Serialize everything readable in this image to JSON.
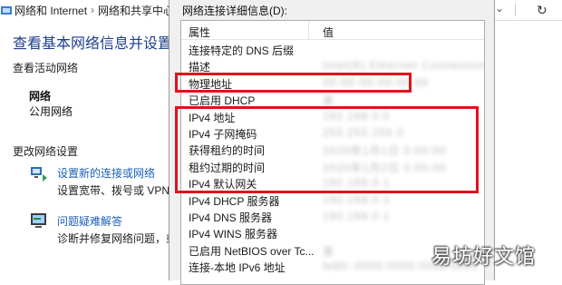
{
  "window": {
    "breadcrumb": [
      "网络和 Internet",
      "网络和共享中心"
    ],
    "icons": {
      "folder": "network-folder-icon",
      "refresh": "refresh-icon",
      "chevron": "chevron-down-icon"
    }
  },
  "page": {
    "title": "查看基本网络信息并设置连",
    "active_network_label": "查看活动网络",
    "network_name": "网络",
    "network_type": "公用网络",
    "change_settings_label": "更改网络设置",
    "actions": [
      {
        "link": "设置新的连接或网络",
        "desc": "设置宽带、拨号或 VPN 连",
        "icon": "network-setup-icon"
      },
      {
        "link": "问题疑难解答",
        "desc": "诊断并修复网络问题，或",
        "icon": "troubleshoot-icon"
      }
    ]
  },
  "dialog": {
    "label": "网络连接详细信息(D):",
    "columns": {
      "property": "属性",
      "value": "值"
    },
    "rows": [
      {
        "key": "连接特定的 DNS 后缀",
        "value": ""
      },
      {
        "key": "描述",
        "value": "Intel(R) Ethernet Connection"
      },
      {
        "key": "物理地址",
        "value": "00-00-00-00-00-00"
      },
      {
        "key": "已启用 DHCP",
        "value": "是"
      },
      {
        "key": "IPv4 地址",
        "value": "192.168.0.0"
      },
      {
        "key": "IPv4 子网掩码",
        "value": "255.255.255.0"
      },
      {
        "key": "获得租约的时间",
        "value": "2020年1月1日 0:00:00"
      },
      {
        "key": "租约过期的时间",
        "value": "2020年1月2日 0:00:00"
      },
      {
        "key": "IPv4 默认网关",
        "value": "192.168.0.1"
      },
      {
        "key": "IPv4 DHCP 服务器",
        "value": "192.168.0.1"
      },
      {
        "key": "IPv4 DNS 服务器",
        "value": "192.168.0.1"
      },
      {
        "key": "IPv4 WINS 服务器",
        "value": ""
      },
      {
        "key": "已启用 NetBIOS over Tc...",
        "value": "是"
      },
      {
        "key": "连接-本地 IPv6 地址",
        "value": "fe80::0000:0000:0000:0000"
      }
    ]
  },
  "watermark": "易坊好文馆",
  "colors": {
    "highlight": "#e0121b",
    "link": "#1b5fb6",
    "title": "#1e3f8a"
  }
}
